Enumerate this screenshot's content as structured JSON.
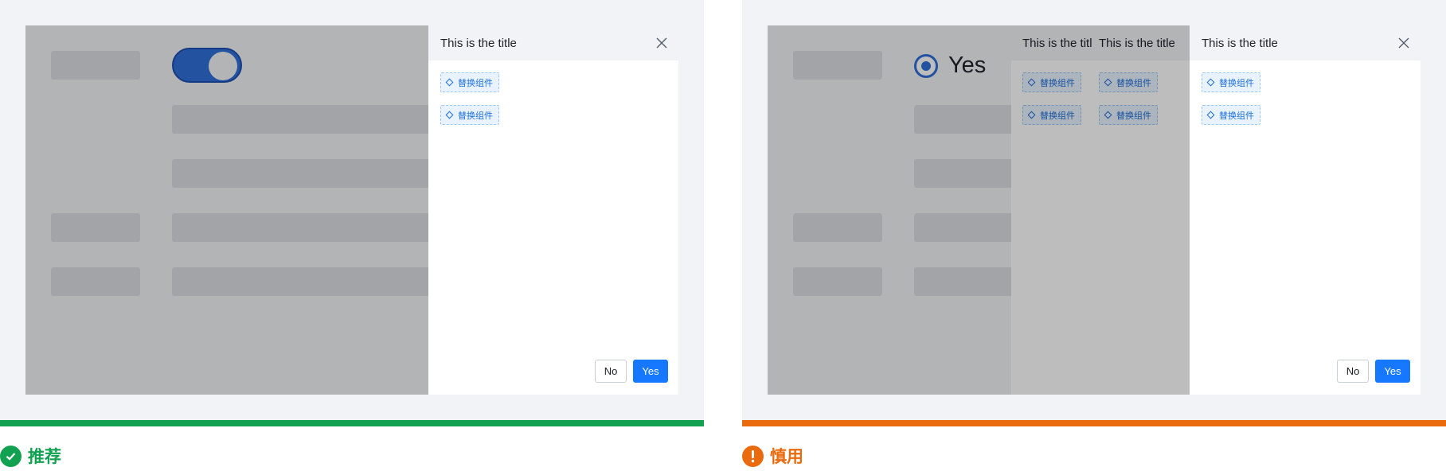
{
  "colors": {
    "good": "#12a150",
    "caution": "#ea6a0e",
    "primary": "#1677ff",
    "toggle": "#2f6fd8"
  },
  "left": {
    "drawer": {
      "title": "This is the title",
      "chips": [
        "替换组件",
        "替换组件"
      ],
      "no_label": "No",
      "yes_label": "Yes"
    },
    "verdict": {
      "label": "推荐",
      "icon": "check-circle-icon"
    }
  },
  "right": {
    "radio_label": "Yes",
    "ghost_drawers": [
      {
        "title": "This is the title",
        "chips": [
          "替换组件",
          "替换组件"
        ]
      },
      {
        "title": "This is the title",
        "chips": [
          "替换组件",
          "替换组件"
        ]
      }
    ],
    "drawer": {
      "title": "This is the title",
      "chips": [
        "替换组件",
        "替换组件"
      ],
      "no_label": "No",
      "yes_label": "Yes"
    },
    "verdict": {
      "label": "慎用",
      "icon": "exclamation-circle-icon"
    }
  }
}
